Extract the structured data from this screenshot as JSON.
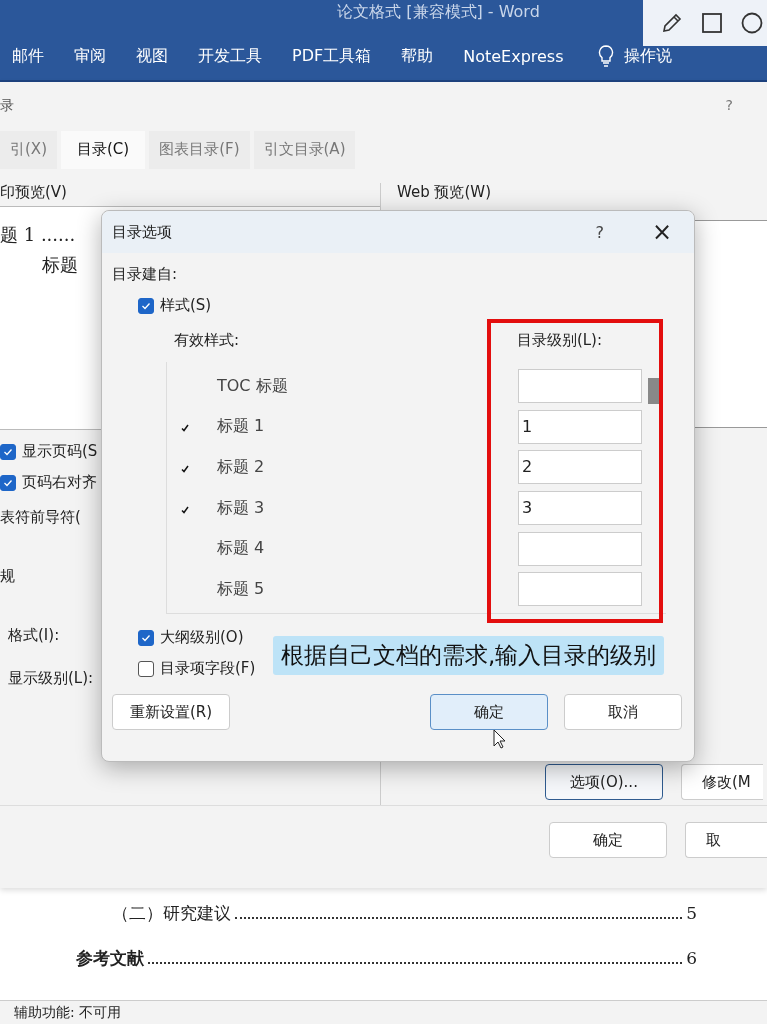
{
  "word": {
    "title": "论文格式 [兼容模式] - Word",
    "ribbon_tabs": [
      "邮件",
      "审阅",
      "视图",
      "开发工具",
      "PDF工具箱",
      "帮助",
      "NoteExpress"
    ],
    "tell_me": "操作说"
  },
  "toc_dialog": {
    "title": "录",
    "help": "?",
    "tabs": [
      {
        "label": "引(X)",
        "selected": false
      },
      {
        "label": "目录(C)",
        "selected": true
      },
      {
        "label": "图表目录(F)",
        "selected": false
      },
      {
        "label": "引文目录(A)",
        "selected": false
      }
    ],
    "print_preview_label": "印预览(V)",
    "preview_lines": [
      "题 1 ......",
      "标题"
    ],
    "web_preview_label": "Web 预览(W)",
    "options": [
      {
        "label": "显示页码(S",
        "checked": true
      },
      {
        "label": "页码右对齐",
        "checked": true
      }
    ],
    "tab_leader_label": "表符前导符(",
    "general_heading": "规",
    "format_label": "格式(I):",
    "show_levels_label": "显示级别(L):",
    "options_button": "选项(O)...",
    "modify_button": "修改(M",
    "ok_button": "确定",
    "cancel_button": "取"
  },
  "options_dialog": {
    "title": "目录选项",
    "help": "?",
    "close": "×",
    "build_from": "目录建自:",
    "styles": {
      "label": "样式(S)",
      "checked": true
    },
    "available_styles_label": "有效样式:",
    "level_label": "目录级别(L):",
    "styles_list": [
      {
        "name": "TOC 标题",
        "used": false
      },
      {
        "name": "标题 1",
        "used": true,
        "level": "1"
      },
      {
        "name": "标题 2",
        "used": true,
        "level": "2"
      },
      {
        "name": "标题 3",
        "used": true,
        "level": "3"
      },
      {
        "name": "标题 4",
        "used": false
      },
      {
        "name": "标题 5",
        "used": false
      }
    ],
    "outline_levels": {
      "label": "大纲级别(O)",
      "checked": true
    },
    "entry_fields": {
      "label": "目录项字段(F)",
      "checked": false
    },
    "reset_button": "重新设置(R)",
    "ok_button": "确定",
    "cancel_button": "取消"
  },
  "caption": "根据自己文档的需求,输入目录的级别",
  "document_rows": [
    {
      "kind": "subsection",
      "text": "（二）研究建议",
      "page": "5"
    },
    {
      "kind": "section",
      "text": "参考文献",
      "page": "6"
    }
  ],
  "status_bar": {
    "text": "辅助功能: 不可用"
  }
}
